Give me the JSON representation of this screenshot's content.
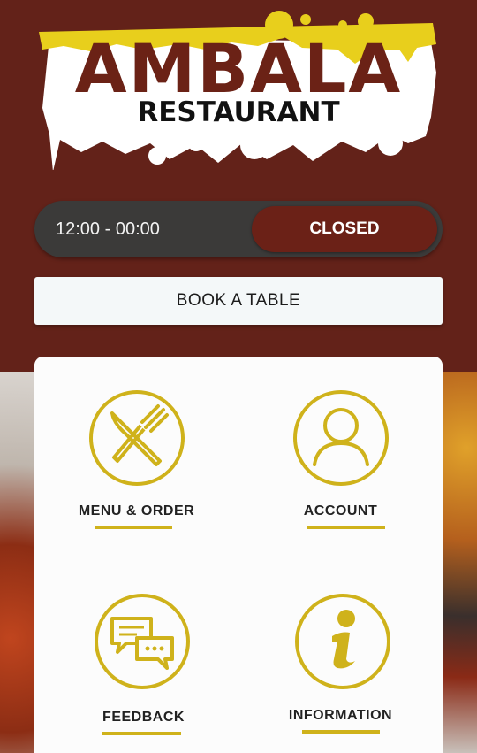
{
  "logo": {
    "title": "AMBALA",
    "subtitle": "RESTAURANT"
  },
  "hours": {
    "time": "12:00 - 00:00",
    "status": "CLOSED"
  },
  "book_button": "BOOK A TABLE",
  "tiles": [
    {
      "label": "MENU & ORDER",
      "icon": "fork-knife-icon"
    },
    {
      "label": "ACCOUNT",
      "icon": "user-icon"
    },
    {
      "label": "FEEDBACK",
      "icon": "chat-bubbles-icon"
    },
    {
      "label": "INFORMATION",
      "icon": "info-icon"
    }
  ],
  "colors": {
    "header": "#632219",
    "accent": "#cfb21b",
    "status_pill": "#6b2117",
    "hours_pill": "#3b3a39"
  }
}
